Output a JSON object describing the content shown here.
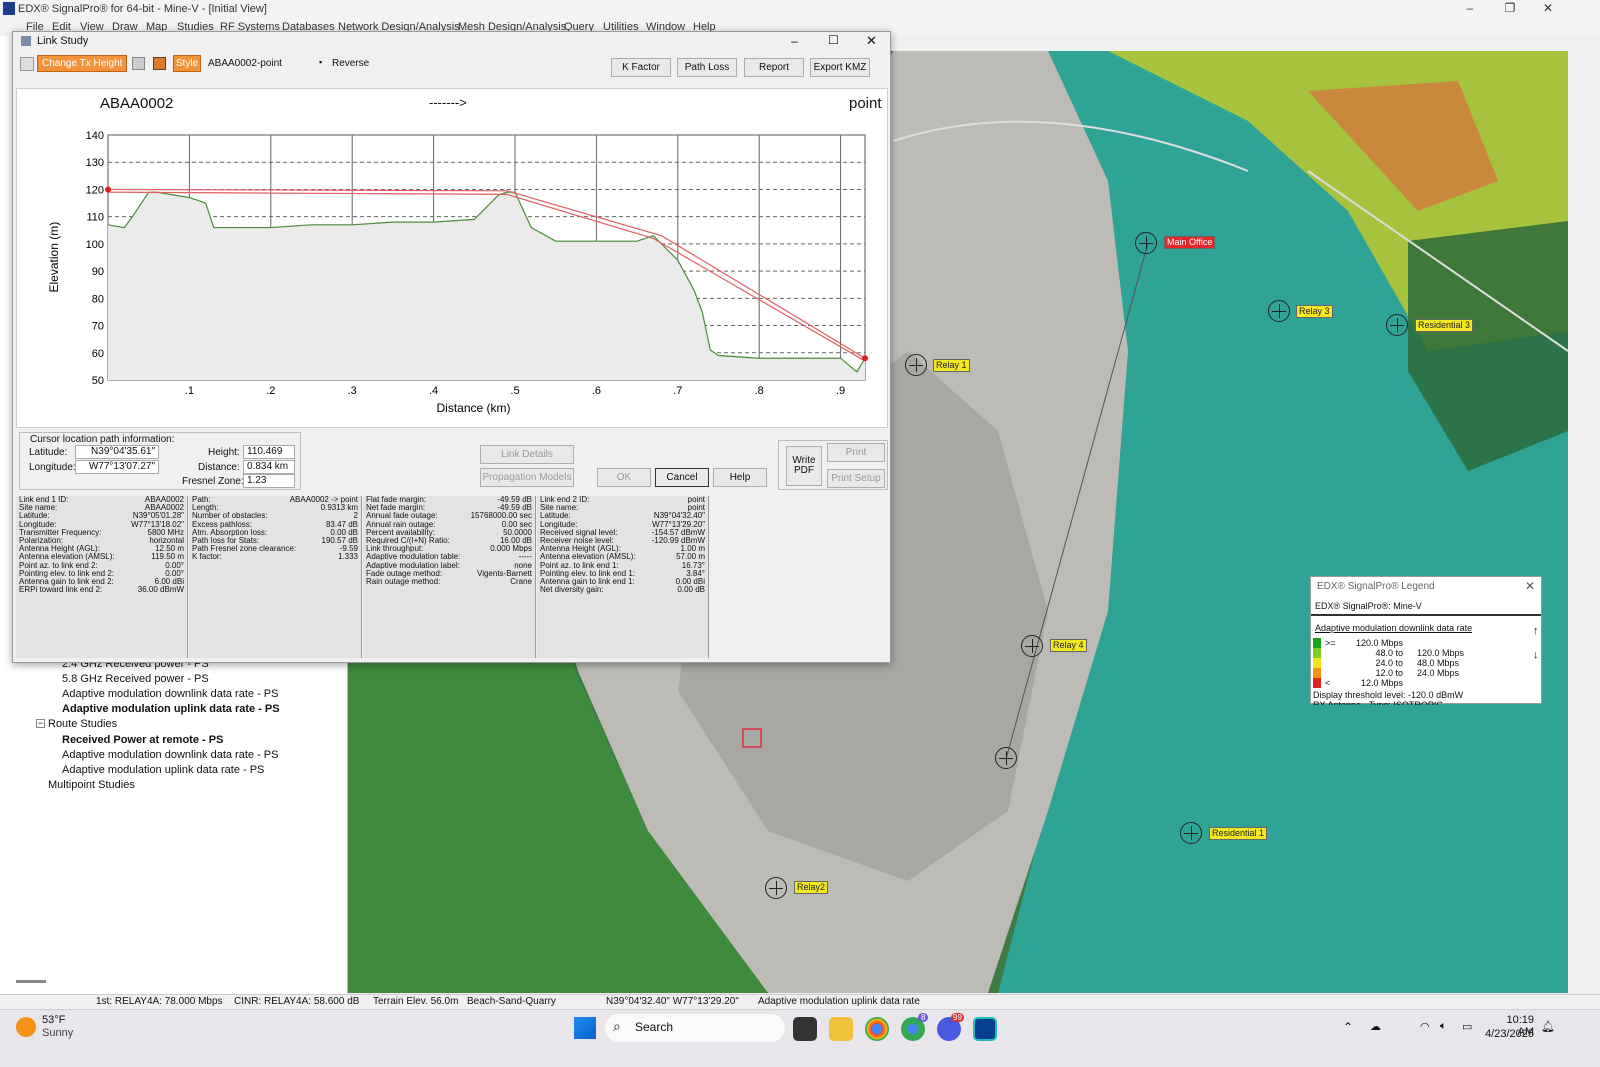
{
  "window": {
    "title": "EDX® SignalPro® for 64-bit - Mine-V - [Initial View]"
  },
  "menu": [
    "File",
    "Edit",
    "View",
    "Draw",
    "Map",
    "Studies",
    "RF Systems",
    "Databases",
    "Network Design/Analysis",
    "Mesh Design/Analysis",
    "Query",
    "Utilities",
    "Window",
    "Help"
  ],
  "tree": {
    "items": [
      {
        "label": "2.4 GHz Received power - PS",
        "bold": false
      },
      {
        "label": "5.8 GHz Received power - PS",
        "bold": false
      },
      {
        "label": "Adaptive modulation downlink data rate - PS",
        "bold": false
      },
      {
        "label": "Adaptive modulation uplink data rate - PS",
        "bold": true
      },
      {
        "label": "Route Studies",
        "bold": false
      },
      {
        "label": "Received Power at remote - PS",
        "bold": true
      },
      {
        "label": "Adaptive modulation downlink data rate - PS",
        "bold": false
      },
      {
        "label": "Adaptive modulation uplink data rate - PS",
        "bold": false
      },
      {
        "label": "Multipoint Studies",
        "bold": false
      }
    ]
  },
  "dialog": {
    "title": "Link Study",
    "toolbar": {
      "change_tx": "Change Tx Height",
      "style": "Style",
      "link_name": "ABAA0002-point",
      "reverse": "Reverse"
    },
    "buttons": {
      "k_factor": "K Factor",
      "path_loss": "Path Loss",
      "report": "Report",
      "export_kmz": "Export KMZ",
      "link_details": "Link Details",
      "propagation_models": "Propagation Models",
      "ok": "OK",
      "cancel": "Cancel",
      "help": "Help",
      "write_pdf_1": "Write",
      "write_pdf_2": "PDF",
      "print": "Print",
      "print_setup": "Print Setup"
    },
    "header": {
      "left": "ABAA0002",
      "arrow": "------->",
      "right": "point"
    },
    "cursor": {
      "group": "Cursor location path information:",
      "lat_label": "Latitude:",
      "lat": "N39°04'35.61\"",
      "lon_label": "Longitude:",
      "lon": "W77°13'07.27\"",
      "height_label": "Height:",
      "height": "110.469 m",
      "dist_label": "Distance:",
      "dist": "0.834 km",
      "fresnel_label": "Fresnel Zone:",
      "fresnel": "1.23"
    },
    "col1": [
      [
        "Link end 1 ID:",
        "ABAA0002"
      ],
      [
        "Site name:",
        "ABAA0002"
      ],
      [
        "Latitude:",
        "N39°05'01.28\""
      ],
      [
        "Longitude:",
        "W77°13'18.02\""
      ],
      [
        "Transmitter Frequency:",
        "5800 MHz"
      ],
      [
        "Polarization:",
        "horizontal"
      ],
      [
        "Antenna Height (AGL):",
        "12.50 m"
      ],
      [
        "Antenna elevation (AMSL):",
        "119.50 m"
      ],
      [
        "Point az. to link end 2:",
        "0.00°"
      ],
      [
        "Pointing elev. to link end 2:",
        "0.00°"
      ],
      [
        "Antenna gain to link end 2:",
        "6.00 dBi"
      ],
      [
        "ERPi toward link end 2:",
        "36.00 dBmW"
      ]
    ],
    "col2": [
      [
        "Path:",
        "ABAA0002 -> point"
      ],
      [
        "Length:",
        "0.9313 km"
      ],
      [
        "Number of obstacles:",
        "2"
      ],
      [
        "Excess pathloss:",
        "83.47 dB"
      ],
      [
        "Atm. Absorption loss:",
        "0.00 dB"
      ],
      [
        "Path loss for Stats:",
        "190.57 dB"
      ],
      [
        "Path Fresnel zone clearance:",
        "-9.59"
      ],
      [
        "K factor:",
        "1.333"
      ]
    ],
    "col3": [
      [
        "Flat fade margin:",
        "-49.59 dB"
      ],
      [
        "Net fade margin:",
        "-49.59 dB"
      ],
      [
        "Annual fade outage:",
        "15768000.00 sec"
      ],
      [
        "Annual rain outage:",
        "0.00 sec"
      ],
      [
        "Percent availability:",
        "50.0000"
      ],
      [
        "Required C/(I+N) Ratio:",
        "16.00 dB"
      ],
      [
        "Link throughput:",
        "0.000 Mbps"
      ],
      [
        "Adaptive modulation table:",
        "-----"
      ],
      [
        "Adaptive modulation label:",
        "none"
      ],
      [
        "Fade outage method:",
        "Vigents-Barnett"
      ],
      [
        "Rain outage method:",
        "Crane"
      ]
    ],
    "col4": [
      [
        "Link end 2 ID:",
        "point"
      ],
      [
        "Site name:",
        "point"
      ],
      [
        "Latitude:",
        "N39°04'32.40\""
      ],
      [
        "Longitude:",
        "W77°13'29.20\""
      ],
      [
        "Received signal level:",
        "-154.57 dBmW"
      ],
      [
        "Receiver noise level:",
        "-120.99 dBmW"
      ],
      [
        "Antenna Height (AGL):",
        "1.00 m"
      ],
      [
        "Antenna elevation (AMSL):",
        "57.00 m"
      ],
      [
        "Point az. to link end 1:",
        "16.73°"
      ],
      [
        "Pointing elev. to link end 1:",
        "3.84°"
      ],
      [
        "Antenna gain to link end 1:",
        "0.00 dBi"
      ],
      [
        "Net diversity gain:",
        "0.00 dB"
      ]
    ]
  },
  "chart_data": {
    "type": "line",
    "xlabel": "Distance (km)",
    "ylabel": "Elevation (m)",
    "xlim": [
      0,
      0.93
    ],
    "ylim": [
      50,
      140
    ],
    "xticks": [
      ".1",
      ".2",
      ".3",
      ".4",
      ".5",
      ".6",
      ".7",
      ".8",
      ".9"
    ],
    "yticks": [
      50,
      60,
      70,
      80,
      90,
      100,
      110,
      120,
      130,
      140
    ],
    "series": [
      {
        "role": "terrain",
        "color": "#4a8a3a",
        "x": [
          0,
          0.02,
          0.03,
          0.05,
          0.06,
          0.08,
          0.1,
          0.12,
          0.13,
          0.15,
          0.2,
          0.25,
          0.3,
          0.35,
          0.4,
          0.45,
          0.47,
          0.48,
          0.49,
          0.5,
          0.52,
          0.55,
          0.58,
          0.6,
          0.65,
          0.67,
          0.68,
          0.7,
          0.72,
          0.73,
          0.74,
          0.75,
          0.8,
          0.85,
          0.9,
          0.92,
          0.93
        ],
        "y": [
          107,
          106,
          110,
          119,
          119,
          118,
          117,
          115,
          106,
          106,
          106,
          107,
          107,
          108,
          108,
          109,
          115,
          118,
          119,
          119,
          106,
          101,
          101,
          101,
          101,
          103,
          100,
          94,
          83,
          75,
          61,
          59,
          58,
          58,
          58,
          53,
          58
        ]
      },
      {
        "role": "path-upper",
        "color": "#e06060",
        "x": [
          0,
          0.49,
          0.68,
          0.93
        ],
        "y": [
          120,
          119.5,
          103,
          58
        ]
      },
      {
        "role": "path-lower",
        "color": "#e06060",
        "x": [
          0,
          0.49,
          0.67,
          0.93
        ],
        "y": [
          119,
          118.2,
          102,
          57
        ]
      }
    ]
  },
  "map": {
    "labels": [
      {
        "text": "Main Office",
        "red": true
      },
      {
        "text": "Relay 3"
      },
      {
        "text": "Residential 3"
      },
      {
        "text": "Relay 1"
      },
      {
        "text": "Relay 4"
      },
      {
        "text": "Residential 1"
      },
      {
        "text": "Relay2"
      }
    ]
  },
  "legend": {
    "title": "EDX® SignalPro® Legend",
    "project": "EDX® SignalPro®: Mine-V",
    "heading": "Adaptive modulation downlink data rate",
    "rows": [
      {
        "color": "#1aa31a",
        "op": ">=",
        "lo": "120.0 Mbps",
        "hi": ""
      },
      {
        "color": "#7fcc1f",
        "op": "",
        "lo": "48.0 to",
        "hi": "120.0 Mbps"
      },
      {
        "color": "#f1e320",
        "op": "",
        "lo": "24.0 to",
        "hi": "48.0 Mbps"
      },
      {
        "color": "#f29018",
        "op": "",
        "lo": "12.0 to",
        "hi": "24.0 Mbps"
      },
      {
        "color": "#e0231e",
        "op": "<",
        "lo": "12.0 Mbps",
        "hi": ""
      }
    ],
    "threshold": "Display threshold level: -120.0 dBmW",
    "antenna": "RX Antenna - Type: ISOTROPIC"
  },
  "status": {
    "s1": "1st: RELAY4A: 78.000 Mbps",
    "s2": "CINR: RELAY4A: 58.600 dB",
    "s3": "Terrain Elev. 56.0m",
    "s4": "Beach-Sand-Quarry",
    "s5": "N39°04'32.40\" W77°13'29.20\"",
    "s6": "Adaptive modulation uplink data rate"
  },
  "taskbar": {
    "temp": "53°F",
    "weather": "Sunny",
    "search": "Search",
    "time": "10:19 AM",
    "date": "4/23/2025",
    "badge1": "8",
    "badge2": "99"
  }
}
